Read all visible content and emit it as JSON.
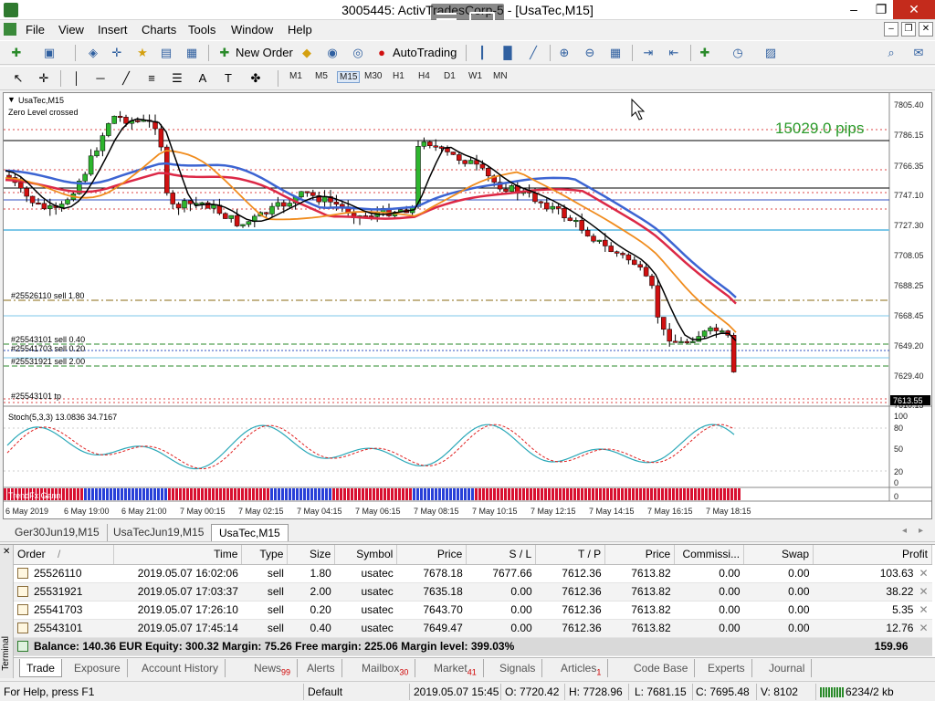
{
  "window": {
    "title": "3005445: ActivTradesCorp-5 - [UsaTec,M15]"
  },
  "menu": [
    "File",
    "View",
    "Insert",
    "Charts",
    "Tools",
    "Window",
    "Help"
  ],
  "toolbar": {
    "new_order": "New Order",
    "autotrading": "AutoTrading"
  },
  "timeframes": [
    "M1",
    "M5",
    "M15",
    "M30",
    "H1",
    "H4",
    "D1",
    "W1",
    "MN"
  ],
  "selected_timeframe": "M15",
  "chart": {
    "symbol_label": "UsaTec,M15",
    "indicator_note": "Zero Level crossed",
    "pips_label": "15029.0 pips",
    "current_price": "7613.55",
    "price_ticks": [
      "7805.40",
      "7786.15",
      "7766.35",
      "7747.10",
      "7727.30",
      "7708.05",
      "7688.25",
      "7668.45",
      "7649.20",
      "7629.40",
      "7610.15"
    ],
    "time_ticks": [
      "6 May 2019",
      "6 May 19:00",
      "6 May 21:00",
      "7 May 00:15",
      "7 May 02:15",
      "7 May 04:15",
      "7 May 06:15",
      "7 May 08:15",
      "7 May 10:15",
      "7 May 12:15",
      "7 May 14:15",
      "7 May 16:15",
      "7 May 18:15"
    ],
    "order_labels": [
      "#25526110 sell 1.80",
      "#25543101 sell 0.40",
      "#25541703 sell 0.20",
      "#25531921 sell 2.00",
      "#25543101 tp"
    ],
    "stoch_label": "Stoch(5,3,3) 13.0836 34.7167",
    "stoch_ticks": [
      "100",
      "80",
      "50",
      "20",
      "0"
    ],
    "panel3_label": "TrendFx Gann",
    "panel3_tick": "0",
    "colors": {
      "bull": "#2db52d",
      "bear": "#d01010",
      "ma_black": "#000000",
      "ma_orange": "#f08c1e",
      "ma_red": "#dc2846",
      "ma_blue": "#3c64d2",
      "stoch_main": "#2aa8b8",
      "stoch_signal": "#e02020"
    }
  },
  "chart_tabs": [
    "Ger30Jun19,M15",
    "UsaTecJun19,M15",
    "UsaTec,M15"
  ],
  "terminal": {
    "columns": [
      "Order",
      "Time",
      "Type",
      "Size",
      "Symbol",
      "Price",
      "S / L",
      "T / P",
      "Price",
      "Commissi...",
      "Swap",
      "Profit"
    ],
    "sort_marker": "/",
    "rows": [
      [
        "25526110",
        "2019.05.07 16:02:06",
        "sell",
        "1.80",
        "usatec",
        "7678.18",
        "7677.66",
        "7612.36",
        "7613.82",
        "0.00",
        "0.00",
        "103.63"
      ],
      [
        "25531921",
        "2019.05.07 17:03:37",
        "sell",
        "2.00",
        "usatec",
        "7635.18",
        "0.00",
        "7612.36",
        "7613.82",
        "0.00",
        "0.00",
        "38.22"
      ],
      [
        "25541703",
        "2019.05.07 17:26:10",
        "sell",
        "0.20",
        "usatec",
        "7643.70",
        "0.00",
        "7612.36",
        "7613.82",
        "0.00",
        "0.00",
        "5.35"
      ],
      [
        "25543101",
        "2019.05.07 17:45:14",
        "sell",
        "0.40",
        "usatec",
        "7649.47",
        "0.00",
        "7612.36",
        "7613.82",
        "0.00",
        "0.00",
        "12.76"
      ]
    ],
    "balance_line": "Balance: 140.36 EUR  Equity: 300.32  Margin: 75.26  Free margin: 225.06  Margin level: 399.03%",
    "total_profit": "159.96",
    "side_label": "Terminal",
    "tabs": [
      {
        "label": "Trade",
        "badge": ""
      },
      {
        "label": "Exposure",
        "badge": ""
      },
      {
        "label": "Account History",
        "badge": ""
      },
      {
        "label": "News",
        "badge": "99"
      },
      {
        "label": "Alerts",
        "badge": ""
      },
      {
        "label": "Mailbox",
        "badge": "30"
      },
      {
        "label": "Market",
        "badge": "41"
      },
      {
        "label": "Signals",
        "badge": ""
      },
      {
        "label": "Articles",
        "badge": "1"
      },
      {
        "label": "Code Base",
        "badge": ""
      },
      {
        "label": "Experts",
        "badge": ""
      },
      {
        "label": "Journal",
        "badge": ""
      }
    ]
  },
  "status": {
    "help": "For Help, press F1",
    "profile": "Default",
    "datetime": "2019.05.07 15:45",
    "open": "O: 7720.42",
    "high": "H: 7728.96",
    "low": "L: 7681.15",
    "close": "C: 7695.48",
    "volume": "V: 8102",
    "traffic": "6234/2 kb"
  }
}
